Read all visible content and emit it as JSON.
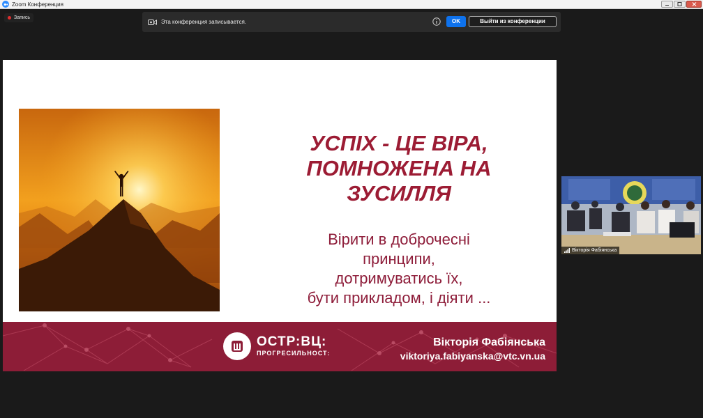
{
  "window": {
    "title": "Zoom Конференция",
    "icon": "zoom-app-icon"
  },
  "recording": {
    "label": "Запись"
  },
  "notice": {
    "text": "Эта конференция записывается.",
    "ok_label": "OK",
    "leave_label": "Выйти из конференции"
  },
  "slide": {
    "title_lines": [
      "УСПІХ - ЦЕ ВІРА,",
      "ПОМНОЖЕНА НА",
      "ЗУСИЛЛЯ"
    ],
    "body_lines": [
      "Вірити в доброчесні",
      "принципи,",
      "дотримуватись їх,",
      "бути прикладом, і діяти ..."
    ],
    "logo_main": "ОСТР:ВЦ:",
    "logo_sub": "ПРОГРЕСИЛЬНОСТ:",
    "author_name": "Вікторія Фабіянська",
    "author_email": "viktoriya.fabiyanska@vtc.vn.ua",
    "accent_color": "#9c1c34",
    "footer_color": "#8d1d37"
  },
  "participant": {
    "name": "Вікторія Фабіянська"
  }
}
